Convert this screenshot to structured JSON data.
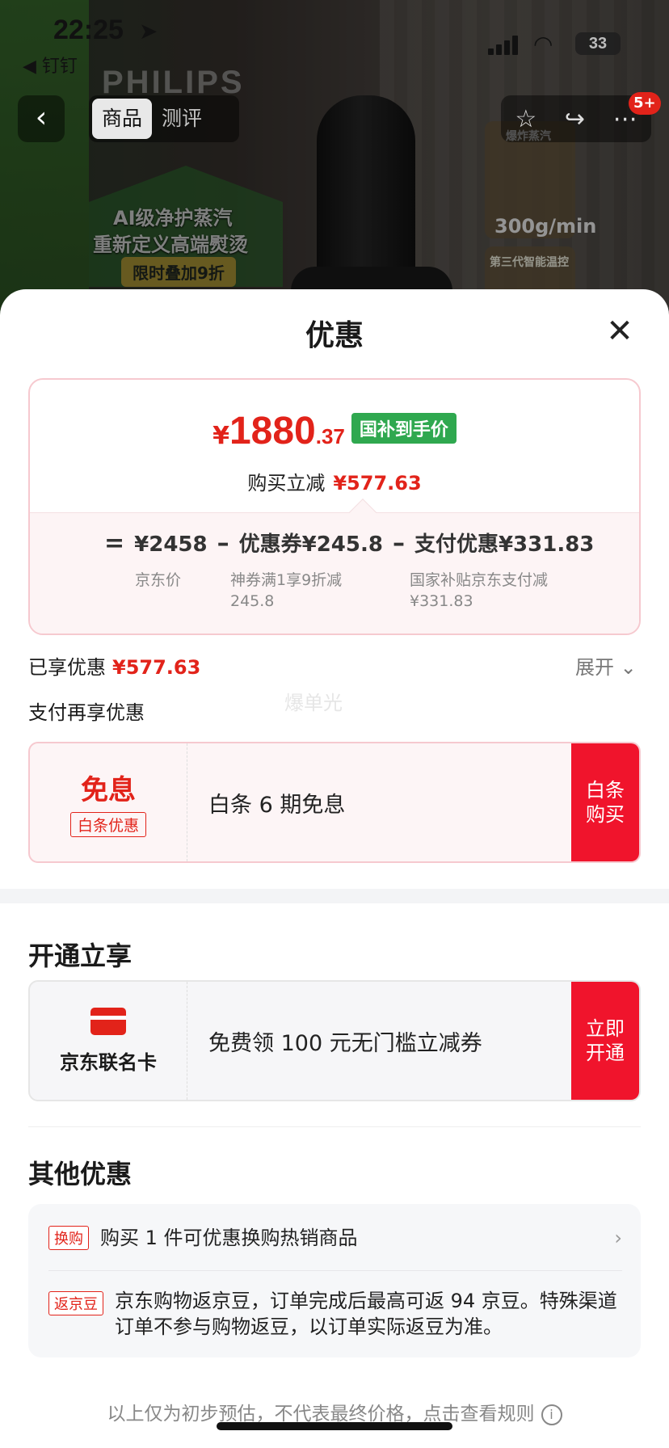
{
  "status_bar": {
    "time": "22:25",
    "back_app": "◀ 钉钉",
    "battery": "33"
  },
  "background": {
    "brand": "PHILIPS",
    "promo_line1": "AI级净护蒸汽",
    "promo_line2": "重新定义高端熨烫",
    "promo_tag": "限时叠加9折",
    "thumb_label_top": "爆炸蒸汽",
    "thumb_label": "300g/min",
    "thumb_label_2": "第三代智能温控"
  },
  "nav": {
    "tabs": [
      {
        "label": "商品",
        "active": true
      },
      {
        "label": "测评",
        "active": false
      }
    ],
    "badge": "5+"
  },
  "sheet": {
    "title": "优惠",
    "price": {
      "currency": "¥",
      "integer": "1880",
      "decimal": ".37",
      "tag": "国补到手价",
      "subtitle_label": "购买立减",
      "subtitle_value": "¥577.63"
    },
    "calc": {
      "equals": "=",
      "jd_price": "¥2458",
      "minus1": "–",
      "coupon": "优惠券¥245.8",
      "minus2": "–",
      "pay_discount": "支付优惠¥331.83",
      "jd_price_label": "京东价",
      "coupon_label_1": "神券满1享9折减",
      "coupon_label_2": "245.8",
      "pay_label_1": "国家补贴京东支付减",
      "pay_label_2": "¥331.83"
    },
    "enjoyed_label": "已享优惠",
    "enjoyed_value": "¥577.63",
    "expand_label": "展开",
    "watermark": "爆单光",
    "pay_more_label": "支付再享优惠",
    "baitiao": {
      "title": "免息",
      "tag": "白条优惠",
      "desc": "白条 6 期免息",
      "cta": "白条购买"
    },
    "open_title": "开通立享",
    "card_offer": {
      "name": "京东联名卡",
      "desc": "免费领 100 元无门槛立减券",
      "cta": "立即开通"
    },
    "other_title": "其他优惠",
    "other": [
      {
        "tag": "换购",
        "text": "购买 1 件可优惠换购热销商品"
      },
      {
        "tag": "返京豆",
        "text": "京东购物返京豆，订单完成后最高可返 94 京豆。特殊渠道订单不参与购物返豆，以订单实际返豆为准。"
      }
    ],
    "footer_note": "以上仅为初步预估，不代表最终价格，点击查看规则"
  },
  "colors": {
    "accent_red": "#e2231a",
    "cta_red": "#f0142c",
    "tag_green": "#2fa84f"
  }
}
